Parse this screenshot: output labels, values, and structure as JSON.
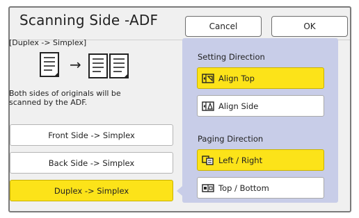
{
  "dialog": {
    "title": "Scanning Side -ADF",
    "cancel_label": "Cancel",
    "ok_label": "OK"
  },
  "left": {
    "mode_label": "[Duplex -> Simplex]",
    "description": "Both sides of originals will be scanned by the ADF.",
    "options": [
      {
        "label": "Front Side -> Simplex",
        "selected": false
      },
      {
        "label": "Back Side -> Simplex",
        "selected": false
      },
      {
        "label": "Duplex -> Simplex",
        "selected": true
      }
    ]
  },
  "setting_direction": {
    "label": "Setting Direction",
    "options": [
      {
        "label": "Align Top",
        "icon": "align-top-icon",
        "selected": true
      },
      {
        "label": "Align Side",
        "icon": "align-side-icon",
        "selected": false
      }
    ]
  },
  "paging_direction": {
    "label": "Paging Direction",
    "options": [
      {
        "label": "Left / Right",
        "icon": "left-right-icon",
        "selected": true
      },
      {
        "label": "Top / Bottom",
        "icon": "top-bottom-icon",
        "selected": false
      }
    ]
  },
  "colors": {
    "selected": "#fce319",
    "panel": "#c8cde8",
    "background": "#f0f0f0"
  }
}
